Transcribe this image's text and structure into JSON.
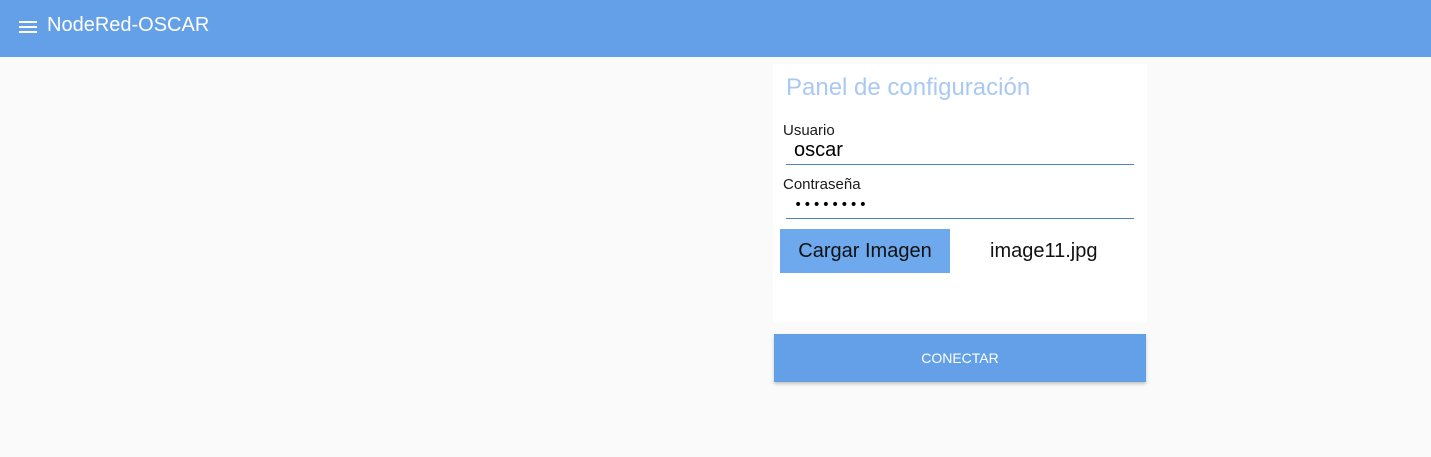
{
  "header": {
    "title": "NodeRed-OSCAR",
    "menu_icon": "menu-icon",
    "background_color": "#64a0e8"
  },
  "panel": {
    "title": "Panel de configuración",
    "title_color": "#a9c9f2",
    "username": {
      "label": "Usuario",
      "value": "oscar"
    },
    "password": {
      "label": "Contraseña",
      "value": "••••••••"
    },
    "upload": {
      "button_label": "Cargar Imagen",
      "file_name": "image11.jpg",
      "button_color": "#6ea8ed"
    }
  },
  "actions": {
    "connect_label": "CONECTAR",
    "connect_color": "#64a0e8"
  }
}
